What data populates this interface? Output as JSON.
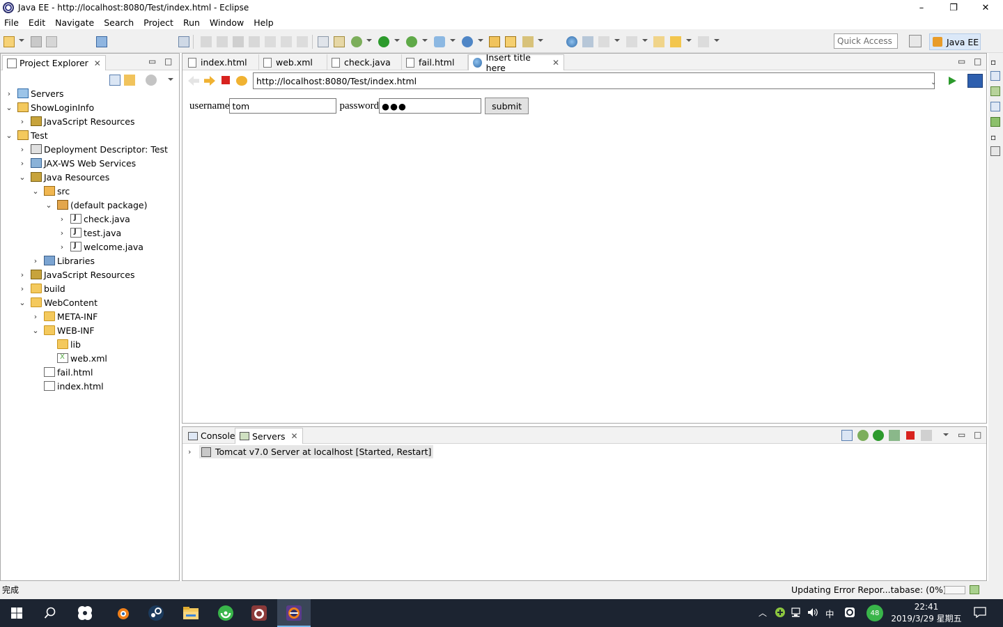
{
  "window": {
    "title": "Java EE - http://localhost:8080/Test/index.html - Eclipse",
    "minimize": "–",
    "restore": "❐",
    "close": "✕"
  },
  "menu": [
    "File",
    "Edit",
    "Navigate",
    "Search",
    "Project",
    "Run",
    "Window",
    "Help"
  ],
  "toolbar": {
    "quick_access": "Quick Access",
    "perspective": "Java EE"
  },
  "project_explorer": {
    "tab_label": "Project Explorer",
    "tree": [
      {
        "label": "Servers",
        "chev": "›",
        "icon": "servers-folder-icon"
      },
      {
        "label": "ShowLoginInfo",
        "chev": "⌄",
        "icon": "project-icon"
      },
      {
        "label": "JavaScript Resources",
        "chev": "›",
        "icon": "javascript-resources-icon"
      },
      {
        "label": "Test",
        "chev": "⌄",
        "icon": "project-icon"
      },
      {
        "label": "Deployment Descriptor: Test",
        "chev": "›",
        "icon": "deployment-descriptor-icon"
      },
      {
        "label": "JAX-WS Web Services",
        "chev": "›",
        "icon": "web-services-icon"
      },
      {
        "label": "Java Resources",
        "chev": "⌄",
        "icon": "java-resources-icon"
      },
      {
        "label": "src",
        "chev": "⌄",
        "icon": "source-folder-icon"
      },
      {
        "label": "(default package)",
        "chev": "⌄",
        "icon": "package-icon"
      },
      {
        "label": "check.java",
        "chev": "›",
        "icon": "java-file-icon"
      },
      {
        "label": "test.java",
        "chev": "›",
        "icon": "java-file-icon"
      },
      {
        "label": "welcome.java",
        "chev": "›",
        "icon": "java-file-icon"
      },
      {
        "label": "Libraries",
        "chev": "›",
        "icon": "libraries-icon"
      },
      {
        "label": "JavaScript Resources",
        "chev": "›",
        "icon": "javascript-resources-icon"
      },
      {
        "label": "build",
        "chev": "›",
        "icon": "folder-icon"
      },
      {
        "label": "WebContent",
        "chev": "⌄",
        "icon": "folder-icon"
      },
      {
        "label": "META-INF",
        "chev": "›",
        "icon": "folder-icon"
      },
      {
        "label": "WEB-INF",
        "chev": "⌄",
        "icon": "folder-icon"
      },
      {
        "label": "lib",
        "chev": "",
        "icon": "folder-icon"
      },
      {
        "label": "web.xml",
        "chev": "",
        "icon": "xml-file-icon"
      },
      {
        "label": "fail.html",
        "chev": "",
        "icon": "html-file-icon"
      },
      {
        "label": "index.html",
        "chev": "",
        "icon": "html-file-icon"
      }
    ]
  },
  "editor": {
    "tabs": [
      {
        "label": "index.html",
        "icon": "html-file-icon",
        "active": false
      },
      {
        "label": "web.xml",
        "icon": "xml-file-icon",
        "active": false
      },
      {
        "label": "check.java",
        "icon": "java-file-icon",
        "active": false
      },
      {
        "label": "fail.html",
        "icon": "html-file-icon",
        "active": false
      },
      {
        "label": "Insert title here",
        "icon": "globe-icon",
        "active": true
      }
    ],
    "url": "http://localhost:8080/Test/index.html",
    "form": {
      "username_label": "username",
      "username_value": "tom",
      "password_label": "password",
      "password_value": "●●●",
      "submit_label": "submit"
    }
  },
  "bottom": {
    "tabs": [
      {
        "label": "Console",
        "active": false
      },
      {
        "label": "Servers",
        "active": true
      }
    ],
    "server_entry": "Tomcat v7.0 Server at localhost  [Started, Restart]"
  },
  "status": {
    "left": "完成",
    "right": "Updating Error Repor...tabase: (0%)"
  },
  "taskbar": {
    "tray_ime": "中",
    "tray_badge": "48",
    "clock_time": "22:41",
    "clock_date": "2019/3/29 星期五"
  }
}
